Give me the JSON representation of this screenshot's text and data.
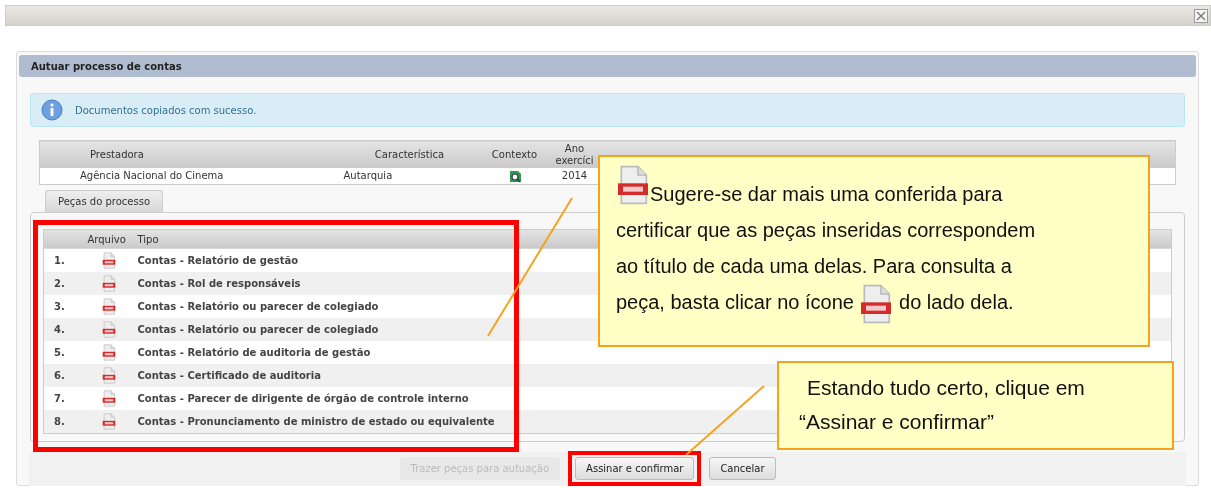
{
  "dialog": {
    "title": "Autuar processo de contas"
  },
  "alert": {
    "text": "Documentos copiados com sucesso."
  },
  "summary_table": {
    "columns": [
      "Prestadora",
      "Característica",
      "Contexto",
      "Ano exercíci"
    ],
    "rows": [
      {
        "prestadora": "Agência Nacional do Cinema",
        "caracteristica": "Autarquia",
        "ano": "2014"
      }
    ]
  },
  "pieces": {
    "tab": "Peças do processo",
    "highlighted": true,
    "columns": [
      "Arquivo",
      "Tipo"
    ],
    "rows": [
      {
        "number": "1.",
        "tipo": "Contas - Relatório de gestão"
      },
      {
        "number": "2.",
        "tipo": "Contas - Rol de responsáveis"
      },
      {
        "number": "3.",
        "tipo": "Contas - Relatório ou parecer de colegiado"
      },
      {
        "number": "4.",
        "tipo": "Contas - Relatório ou parecer de colegiado"
      },
      {
        "number": "5.",
        "tipo": "Contas - Relatório de auditoria de gestão"
      },
      {
        "number": "6.",
        "tipo": "Contas - Certificado de auditoria"
      },
      {
        "number": "7.",
        "tipo": "Contas - Parecer de dirigente de órgão de controle interno"
      },
      {
        "number": "8.",
        "tipo": "Contas - Pronunciamento de ministro de estado ou equivalente"
      }
    ]
  },
  "buttons": [
    {
      "label": "Trazer peças para autuação",
      "disabled": true,
      "highlighted": false
    },
    {
      "label": "Assinar e confirmar",
      "disabled": false,
      "highlighted": true
    },
    {
      "label": "Cancelar",
      "disabled": false,
      "highlighted": false
    }
  ],
  "callouts": [
    {
      "kind": "icon",
      "lines": [
        "Sugere-se dar mais uma conferida para",
        "certificar que as peças inseridas correspondem",
        "ao título de cada uma delas. Para consulta a",
        "peça, basta clicar no ícone"
      ],
      "text_after": "do lado dela."
    },
    {
      "kind": "lines",
      "lines": [
        "Estando tudo certo, clique em",
        "“Assinar e confirmar”"
      ]
    }
  ]
}
